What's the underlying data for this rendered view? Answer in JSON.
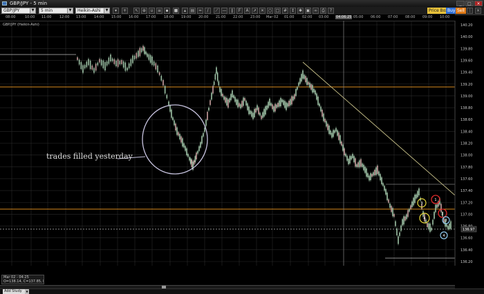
{
  "window": {
    "title": "GBP/JPY - 5 min",
    "controls": [
      "_",
      "□",
      "×"
    ]
  },
  "toolbar": {
    "symbol": "GBP/JPY",
    "interval": "5 min",
    "chart_type": "Heikin-Ashi",
    "price_box_label": "Price Box",
    "buy_label": "Buy",
    "sell_label": "Sell"
  },
  "chart": {
    "instrument_label": "GBP/JPY (Heikin-Ashi)",
    "time_labels": [
      "08:00",
      "10:00",
      "11:00",
      "12:00",
      "13:00",
      "14:00",
      "15:00",
      "16:00",
      "17:00",
      "18:00",
      "19:00",
      "20:00",
      "21:00",
      "22:00",
      "23:00",
      "Mar 02",
      "01:00",
      "02:00",
      "03:00",
      "04:06:25",
      "05:00",
      "06:00",
      "07:00",
      "08:00",
      "09:00",
      "10:00"
    ],
    "price_labels": [
      "140.20",
      "140.00",
      "139.80",
      "139.60",
      "139.40",
      "139.20",
      "139.00",
      "138.80",
      "138.60",
      "138.40",
      "138.20",
      "138.00",
      "137.80",
      "137.60",
      "137.40",
      "137.20",
      "137.00",
      "136.80",
      "136.60",
      "136.40",
      "136.20",
      "136.00"
    ],
    "current_price_label": "136.97",
    "annotation": "trades filled yesterday",
    "markers": [
      "3",
      "4",
      "1",
      "2",
      "3",
      "4"
    ],
    "colors": {
      "background": "#000000",
      "grid": "#2a2a2a",
      "resistance": "#d98a1e",
      "trendline": "#c9c28a",
      "circle_annotation": "#c8c4e0",
      "marker_yellow": "#e8d83a",
      "marker_red": "#e02a2a",
      "marker_blue": "#8ec8ee",
      "candles": "#9fc4a8"
    }
  },
  "ohlc_box": {
    "line1": "Mar 02 - 04:25",
    "line2": "O=138.14, C=137.85, H=138.14, L=137.73"
  },
  "status": {
    "add_study_label": "Add Study"
  }
}
